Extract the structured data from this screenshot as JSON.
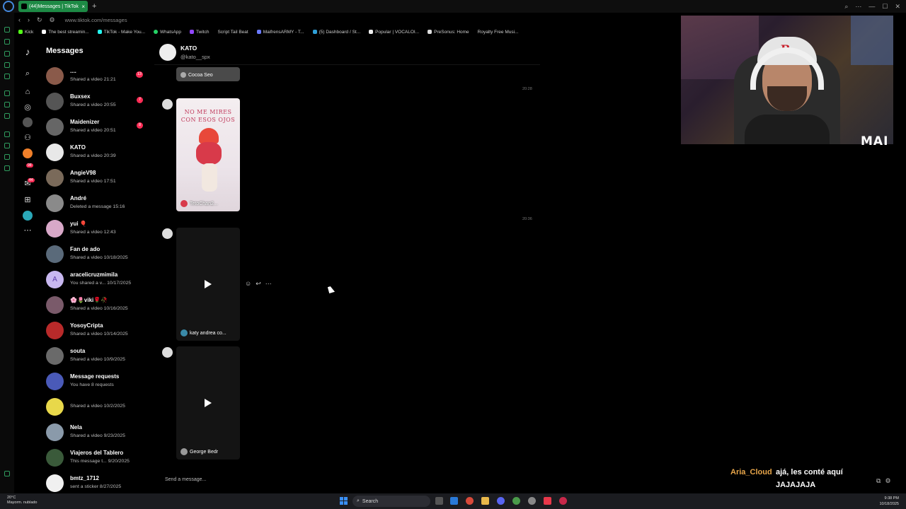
{
  "browser": {
    "tab_title": "(44)Messages | TikTok",
    "url": "www.tiktok.com/messages",
    "bookmarks": [
      "Kick",
      "The best streamin...",
      "TikTok - Make You...",
      "WhatsApp",
      "Twitch",
      "Script Tail Beat",
      "MaifrensARMY - T...",
      "(5) Dashboard / St...",
      "Popular | VOCALOI...",
      "PreSonus: Home",
      "Royalty Free Musi..."
    ]
  },
  "sidebar": {
    "title": "Messages",
    "badge_activity": "98",
    "badge_inbox": "44"
  },
  "conversations": [
    {
      "name": "....",
      "preview": "Shared a video 21:21",
      "unread": "13",
      "color": "#8a5a4a"
    },
    {
      "name": "Buxsex",
      "preview": "Shared a video 20:55",
      "unread": "7",
      "color": "#555"
    },
    {
      "name": "Maidenizer",
      "preview": "Shared a video 20:51",
      "unread": "8",
      "color": "#666"
    },
    {
      "name": "KATO",
      "preview": "Shared a video 20:39",
      "unread": "",
      "color": "#e8e8e8"
    },
    {
      "name": "AngieV98",
      "preview": "Shared a video 17:51",
      "unread": "",
      "color": "#7a6a5a"
    },
    {
      "name": "André",
      "preview": "Deleted a message 15:16",
      "unread": "",
      "color": "#8a8a8a"
    },
    {
      "name": "yui 🎈",
      "preview": "Shared a video 12:43",
      "unread": "",
      "color": "#d8a8c8"
    },
    {
      "name": "Fan de ado",
      "preview": "Shared a video 10/18/2025",
      "unread": "",
      "color": "#5a6a7a"
    },
    {
      "name": "aracelicruzmimila",
      "preview": "You shared a v... 10/17/2025",
      "unread": "",
      "color": "#c8b8f0",
      "initial": "A"
    },
    {
      "name": "🌸🌷viki🌹🥀",
      "preview": "Shared a video 10/16/2025",
      "unread": "",
      "color": "#7a5a6a"
    },
    {
      "name": "YosoyCripta",
      "preview": "Shared a video 10/14/2025",
      "unread": "",
      "color": "#b82a2a"
    },
    {
      "name": "souta",
      "preview": "Shared a video 10/9/2025",
      "unread": "",
      "color": "#6a6a6a"
    },
    {
      "name": "Message requests",
      "preview": "You have 8 requests",
      "unread": "",
      "color": "#4a5ab8"
    },
    {
      "name": "",
      "preview": "Shared a video 10/2/2025",
      "unread": "",
      "color": "#e8d84a"
    },
    {
      "name": "Nela",
      "preview": "Shared a video 9/23/2025",
      "unread": "",
      "color": "#8a9aaa"
    },
    {
      "name": "Viajeros del Tablero",
      "preview": "This message t... 9/20/2025",
      "unread": "",
      "color": "#3a5a3a"
    },
    {
      "name": "bmtz_1712",
      "preview": "sent a sticker 8/27/2025",
      "unread": "",
      "color": "#f0f0f0"
    }
  ],
  "chat": {
    "name": "KATO",
    "handle": "@kato__spx",
    "messages": [
      {
        "label": "Cocoa Seo"
      },
      {
        "timestamp": "20:28"
      },
      {
        "label": "TetoChan2...",
        "poster_text": "NO ME MIRES CON ESOS OJOS"
      },
      {
        "timestamp": "20:36"
      },
      {
        "label": "katy andrea co..."
      },
      {
        "label": "George Bedr"
      }
    ],
    "input_placeholder": "Send a message..."
  },
  "overlay": {
    "cam_tag": "MAI",
    "chat_user": "Aria_Cloud",
    "chat_message_line1": "ajá, les conté aquí",
    "chat_message_line2": "JAJAJAJA"
  },
  "taskbar": {
    "weather_temp": "20°C",
    "weather_desc": "Mayorm. nublado",
    "search_label": "Search",
    "time": "9:38 PM",
    "date": "10/18/2025"
  }
}
